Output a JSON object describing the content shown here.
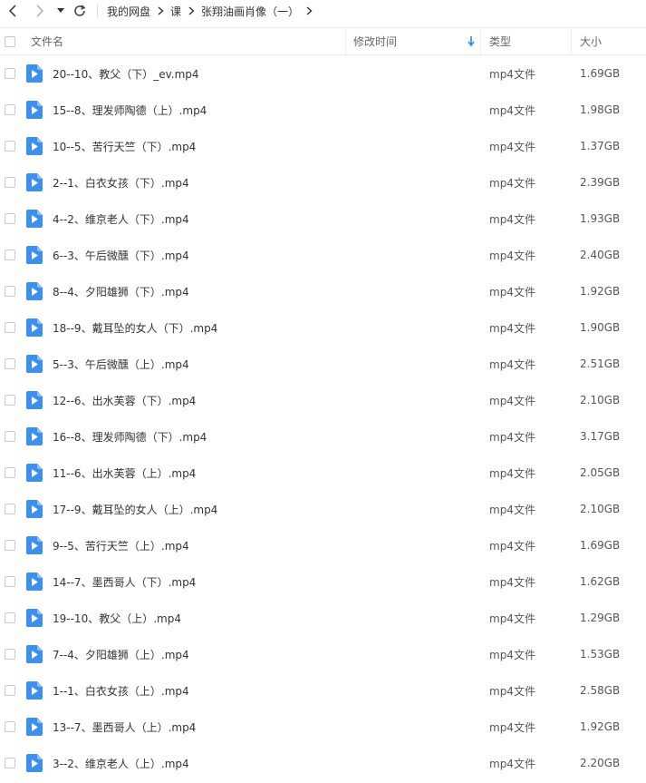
{
  "breadcrumb": [
    "我的网盘",
    "课",
    "张翔油画肖像（一）"
  ],
  "columns": {
    "name": "文件名",
    "modified": "修改时间",
    "type": "类型",
    "size": "大小"
  },
  "files": [
    {
      "name": "20--10、教父（下）_ev.mp4",
      "type": "mp4文件",
      "size": "1.69GB"
    },
    {
      "name": "15--8、理发师陶德（上）.mp4",
      "type": "mp4文件",
      "size": "1.98GB"
    },
    {
      "name": "10--5、苦行天竺（下）.mp4",
      "type": "mp4文件",
      "size": "1.37GB"
    },
    {
      "name": "2--1、白衣女孩（下）.mp4",
      "type": "mp4文件",
      "size": "2.39GB"
    },
    {
      "name": "4--2、维京老人（下）.mp4",
      "type": "mp4文件",
      "size": "1.93GB"
    },
    {
      "name": "6--3、午后微醺（下）.mp4",
      "type": "mp4文件",
      "size": "2.40GB"
    },
    {
      "name": "8--4、夕阳雄狮（下）.mp4",
      "type": "mp4文件",
      "size": "1.92GB"
    },
    {
      "name": "18--9、戴耳坠的女人（下）.mp4",
      "type": "mp4文件",
      "size": "1.90GB"
    },
    {
      "name": "5--3、午后微醺（上）.mp4",
      "type": "mp4文件",
      "size": "2.51GB"
    },
    {
      "name": "12--6、出水芙蓉（下）.mp4",
      "type": "mp4文件",
      "size": "2.10GB"
    },
    {
      "name": "16--8、理发师陶德（下）.mp4",
      "type": "mp4文件",
      "size": "3.17GB"
    },
    {
      "name": "11--6、出水芙蓉（上）.mp4",
      "type": "mp4文件",
      "size": "2.05GB"
    },
    {
      "name": "17--9、戴耳坠的女人（上）.mp4",
      "type": "mp4文件",
      "size": "2.10GB"
    },
    {
      "name": "9--5、苦行天竺（上）.mp4",
      "type": "mp4文件",
      "size": "1.69GB"
    },
    {
      "name": "14--7、墨西哥人（下）.mp4",
      "type": "mp4文件",
      "size": "1.62GB"
    },
    {
      "name": "19--10、教父（上）.mp4",
      "type": "mp4文件",
      "size": "1.29GB"
    },
    {
      "name": "7--4、夕阳雄狮（上）.mp4",
      "type": "mp4文件",
      "size": "1.53GB"
    },
    {
      "name": "1--1、白衣女孩（上）.mp4",
      "type": "mp4文件",
      "size": "2.58GB"
    },
    {
      "name": "13--7、墨西哥人（上）.mp4",
      "type": "mp4文件",
      "size": "1.92GB"
    },
    {
      "name": "3--2、维京老人（上）.mp4",
      "type": "mp4文件",
      "size": "2.20GB"
    }
  ],
  "colors": {
    "accent": "#2b8cf0",
    "file_icon": "#3d8ff0"
  },
  "icons": [
    "back-icon",
    "forward-icon",
    "history-dropdown-icon",
    "refresh-icon",
    "chevron-right-icon",
    "sort-down-icon",
    "video-file-icon"
  ]
}
